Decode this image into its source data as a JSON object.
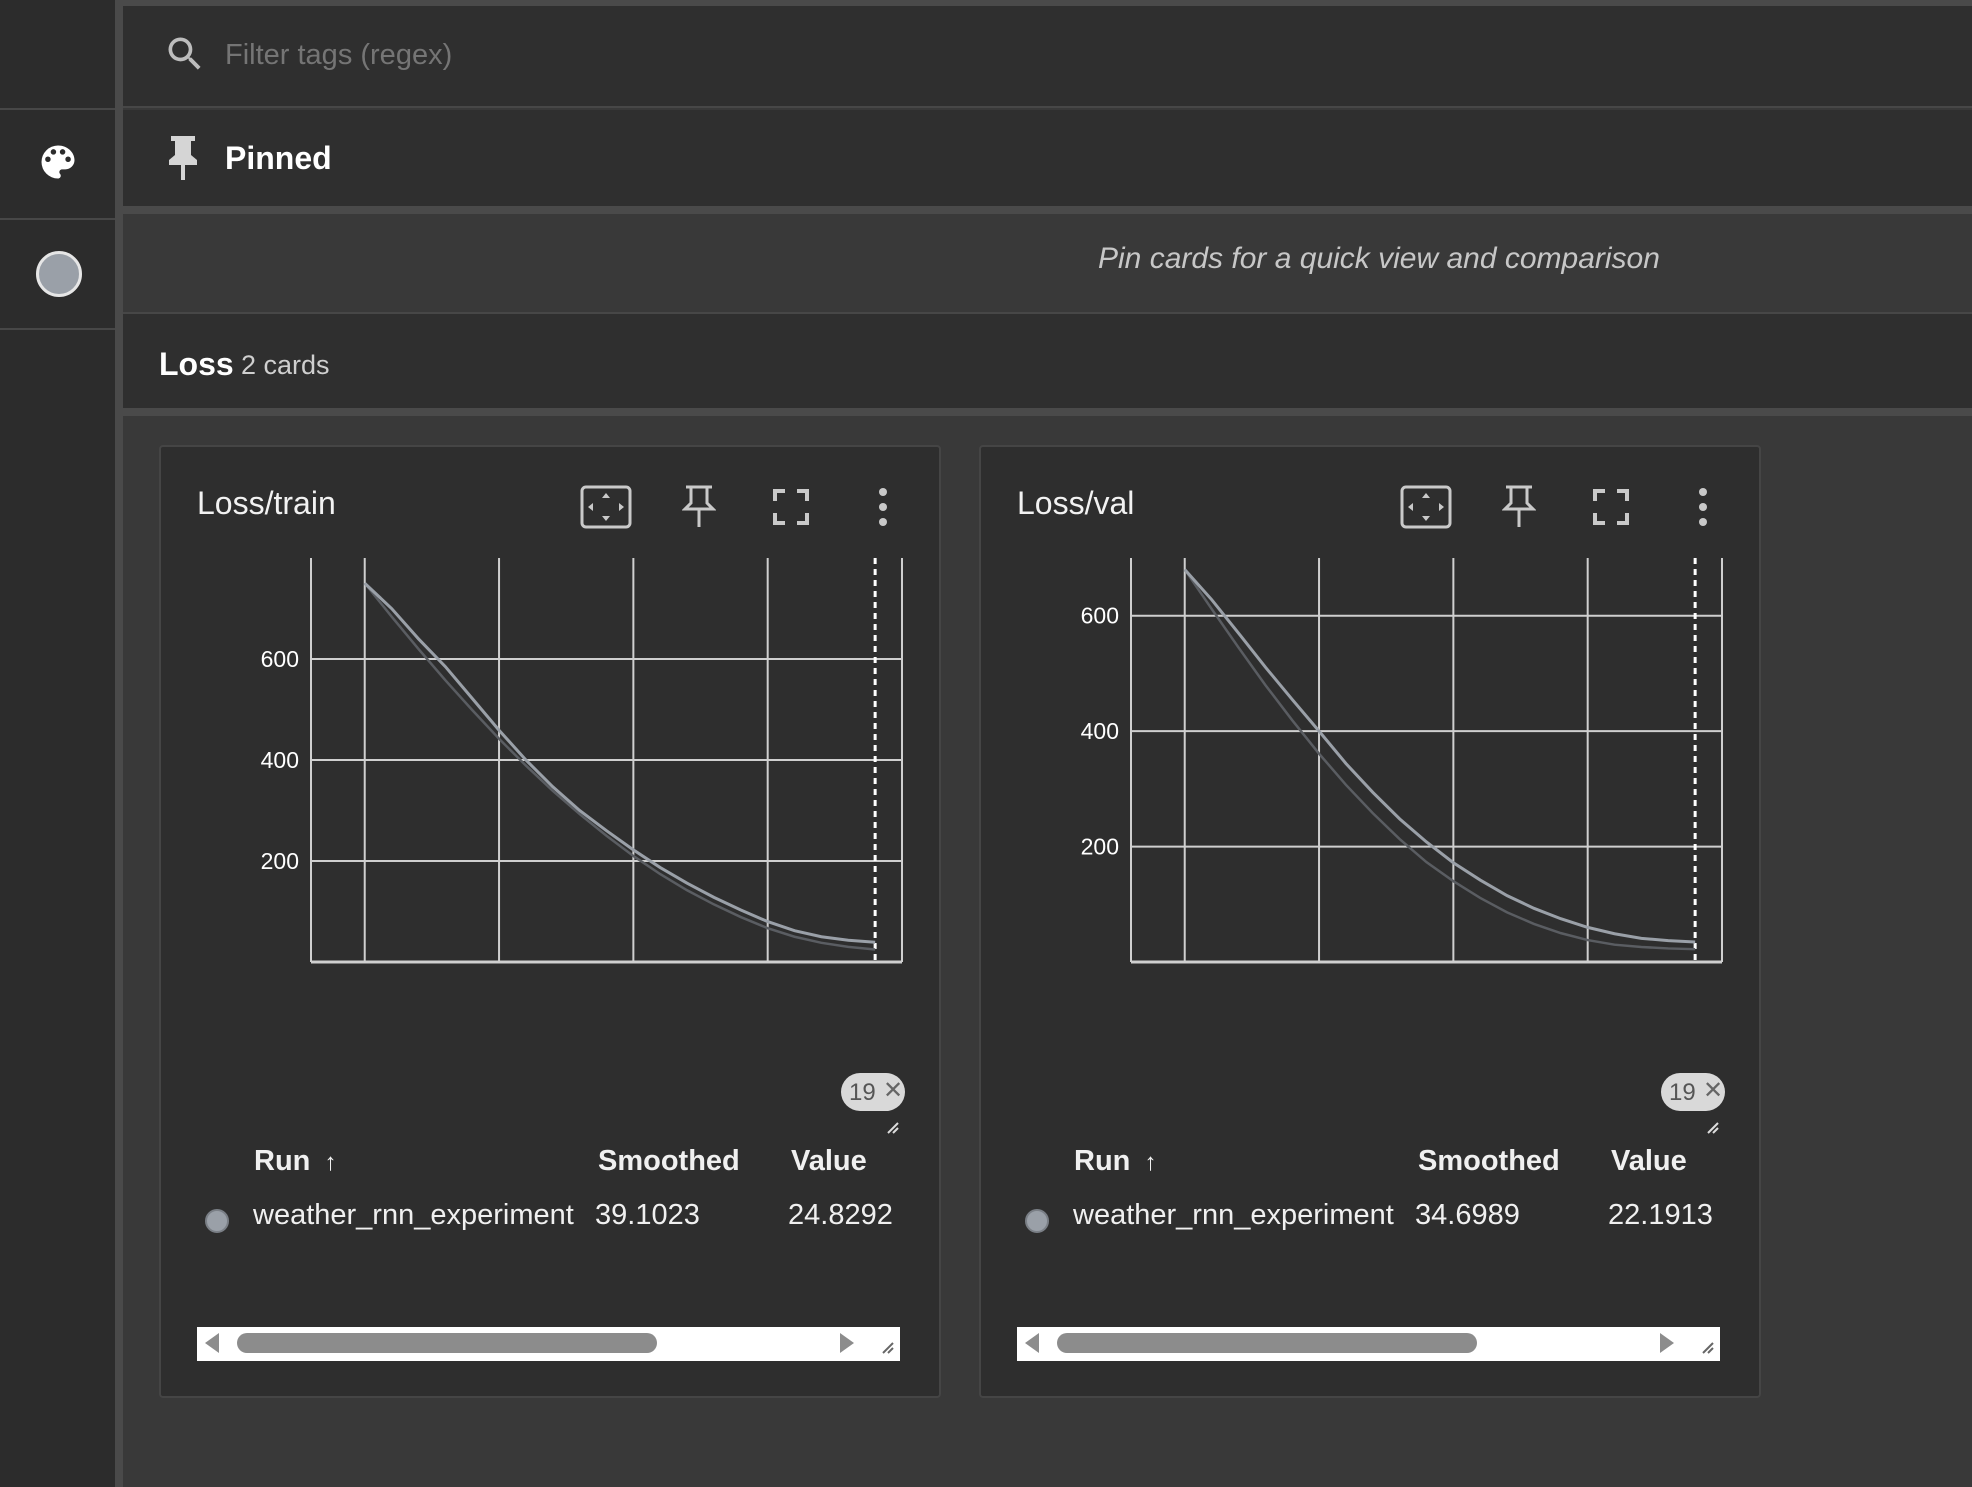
{
  "search": {
    "placeholder": "Filter tags (regex)"
  },
  "pinned": {
    "title": "Pinned",
    "hint": "Pin cards for a quick view and comparison"
  },
  "section": {
    "title": "Loss",
    "count": "2 cards"
  },
  "colors": {
    "run": "#9aa0a8",
    "raw_line": "#5a5d62",
    "background": "#393939"
  },
  "cards": [
    {
      "title": "Loss/train",
      "step_label": "19",
      "table": {
        "headers": {
          "run": "Run",
          "smoothed": "Smoothed",
          "value": "Value"
        },
        "rows": [
          {
            "run": "weather_rnn_experiment",
            "smoothed": "39.1023",
            "value": "24.8292"
          }
        ]
      }
    },
    {
      "title": "Loss/val",
      "step_label": "19",
      "table": {
        "headers": {
          "run": "Run",
          "smoothed": "Smoothed",
          "value": "Value"
        },
        "rows": [
          {
            "run": "weather_rnn_experiment",
            "smoothed": "34.6989",
            "value": "22.1913"
          }
        ]
      }
    }
  ],
  "chart_data": [
    {
      "type": "line",
      "title": "Loss/train",
      "x": [
        0,
        1,
        2,
        3,
        4,
        5,
        6,
        7,
        8,
        9,
        10,
        11,
        12,
        13,
        14,
        15,
        16,
        17,
        18,
        19
      ],
      "xticks": [
        "0",
        "5",
        "10",
        "15"
      ],
      "yticks": [
        "200",
        "400",
        "600"
      ],
      "xlim": [
        -2,
        20
      ],
      "ylim": [
        0,
        800
      ],
      "grid": true,
      "series": [
        {
          "values": [
            750,
            684,
            620,
            558,
            499,
            442,
            389,
            339,
            293,
            250,
            210,
            174,
            142,
            114,
            89,
            67,
            50,
            38,
            30,
            24.8
          ]
        },
        {
          "values": [
            750,
            700,
            640,
            585,
            522,
            459,
            400,
            347,
            300,
            260,
            222,
            187,
            156,
            128,
            103,
            80,
            62,
            50,
            43,
            39.1
          ]
        }
      ]
    },
    {
      "title": "Loss/val",
      "type": "line",
      "x": [
        0,
        1,
        2,
        3,
        4,
        5,
        6,
        7,
        8,
        9,
        10,
        11,
        12,
        13,
        14,
        15,
        16,
        17,
        18,
        19
      ],
      "xticks": [
        "0",
        "5",
        "10",
        "15"
      ],
      "yticks": [
        "200",
        "400",
        "600"
      ],
      "xlim": [
        -2,
        20
      ],
      "ylim": [
        0,
        700
      ],
      "grid": true,
      "series": [
        {
          "values": [
            680,
            612,
            545,
            480,
            419,
            361,
            307,
            258,
            213,
            173,
            140,
            111,
            86,
            66,
            50,
            38,
            30,
            26,
            23.5,
            22.2
          ]
        },
        {
          "values": [
            680,
            628,
            570,
            511,
            455,
            400,
            344,
            294,
            248,
            208,
            172,
            142,
            115,
            93,
            75,
            60,
            49,
            41,
            37,
            34.7
          ]
        }
      ]
    }
  ]
}
